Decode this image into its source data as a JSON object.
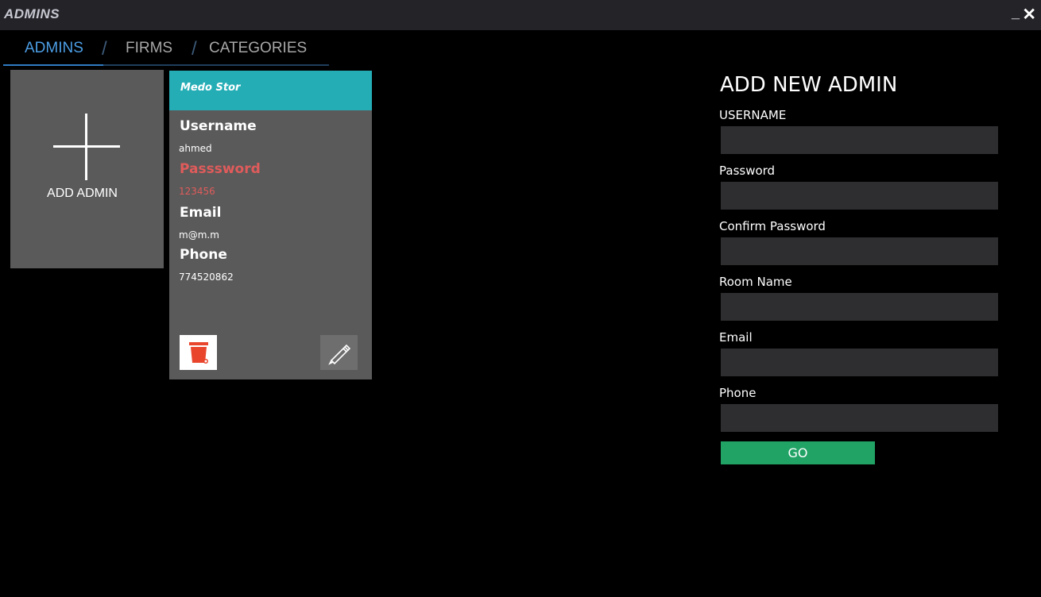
{
  "window": {
    "title": "ADMINS",
    "minimize_glyph": "_",
    "close_glyph": "✕"
  },
  "tabs": [
    {
      "label": "ADMINS",
      "active": true
    },
    {
      "label": "FIRMS",
      "active": false
    },
    {
      "label": "CATEGORIES",
      "active": false
    }
  ],
  "tab_separator": "/",
  "add_tile": {
    "label": "ADD ADMIN",
    "icon": "plus-icon"
  },
  "admin_card": {
    "title": "Medo Stor",
    "header_color": "#25adb6",
    "fields": {
      "username_label": "Username",
      "username_value": "ahmed",
      "password_label": "Passsword",
      "password_value": "123456",
      "email_label": "Email",
      "email_value": "m@m.m",
      "phone_label": "Phone",
      "phone_value": "774520862"
    },
    "delete_icon": "trash-icon",
    "edit_icon": "pencil-icon",
    "delete_color": "#e8452c"
  },
  "form": {
    "title": "ADD NEW ADMIN",
    "fields": [
      {
        "label": "USERNAME",
        "value": ""
      },
      {
        "label": "Password",
        "value": ""
      },
      {
        "label": "Confirm Password",
        "value": ""
      },
      {
        "label": "Room Name",
        "value": ""
      },
      {
        "label": "Email",
        "value": ""
      },
      {
        "label": "Phone",
        "value": ""
      }
    ],
    "submit_label": "GO",
    "submit_color": "#21a366"
  },
  "colors": {
    "background": "#000000",
    "titlebar": "#232328",
    "accent_tab": "#4c9ee6",
    "card_bg": "#5a5a5a",
    "input_bg": "#2e2e31",
    "password_highlight": "#e05b5b"
  }
}
